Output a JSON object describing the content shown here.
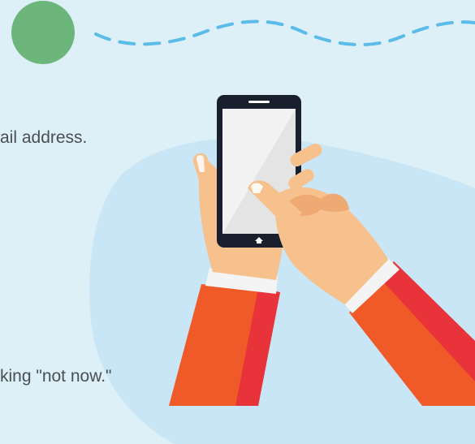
{
  "content": {
    "text_line_1": "ail address.",
    "text_line_2": "king \"not now.\""
  },
  "illustration": {
    "subject": "hands holding smartphone",
    "icons": [
      "green-dot-icon",
      "phone-home-icon"
    ],
    "colors": {
      "background": "#ddeff7",
      "blob": "#c8e6f5",
      "green_dot": "#6cb57b",
      "dashed_line": "#5bbbe9",
      "skin": "#f7c18e",
      "skin_shadow": "#eeaa72",
      "sleeve": "#f05a28",
      "sleeve_shadow": "#e8333a",
      "cuff": "#f4f4f4",
      "phone_body": "#1a1f2e",
      "phone_screen": "#f2f2f2"
    }
  }
}
